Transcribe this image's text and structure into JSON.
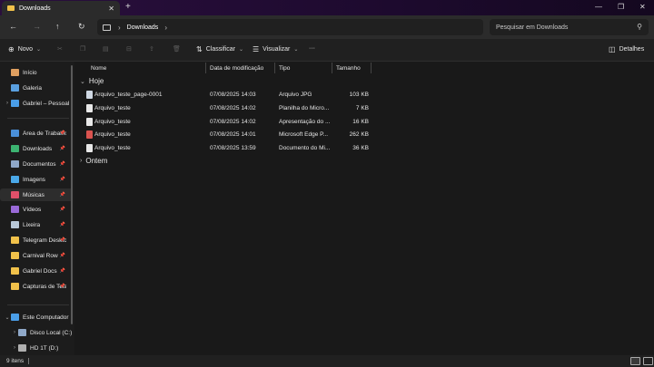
{
  "window": {
    "tab_title": "Downloads",
    "tab_close": "✕",
    "new_tab": "+",
    "minimize": "—",
    "maximize": "❐",
    "close": "✕"
  },
  "nav": {
    "back": "←",
    "forward": "→",
    "up": "↑",
    "refresh": "↻"
  },
  "address": {
    "crumbs": [
      "Downloads"
    ],
    "sep": "›"
  },
  "search": {
    "placeholder": "Pesquisar em Downloads",
    "icon": "⚲"
  },
  "toolbar": {
    "new_label": "Novo",
    "sort_label": "Classificar",
    "view_label": "Visualizar",
    "more": "···",
    "details_label": "Detalhes"
  },
  "sidebar": {
    "items": [
      {
        "label": "Início",
        "icon": "home-icon",
        "color": "#e0a060"
      },
      {
        "label": "Galeria",
        "icon": "gallery-icon",
        "color": "#5aa0e0"
      },
      {
        "label": "Gabriel – Pessoal",
        "icon": "onedrive-icon",
        "color": "#4a9ee8"
      },
      {
        "label": "Área de Trabalho",
        "icon": "desktop-icon",
        "color": "#4a8fd8"
      },
      {
        "label": "Downloads",
        "icon": "download-icon",
        "color": "#3cb371"
      },
      {
        "label": "Documentos",
        "icon": "documents-icon",
        "color": "#8fa8c8"
      },
      {
        "label": "Imagens",
        "icon": "pictures-icon",
        "color": "#4aa8e8"
      },
      {
        "label": "Músicas",
        "icon": "music-icon",
        "color": "#e0506a"
      },
      {
        "label": "Vídeos",
        "icon": "videos-icon",
        "color": "#9a6ad8"
      },
      {
        "label": "Lixeira",
        "icon": "recycle-bin-icon",
        "color": "#b8c8d8"
      },
      {
        "label": "Telegram Desktop",
        "icon": "folder-icon",
        "color": "#f0c14a"
      },
      {
        "label": "Carnival Row",
        "icon": "folder-icon",
        "color": "#f0c14a"
      },
      {
        "label": "Gabriel Docs",
        "icon": "folder-icon",
        "color": "#f0c14a"
      },
      {
        "label": "Capturas de Tela",
        "icon": "folder-icon",
        "color": "#f0c14a"
      },
      {
        "label": "Este Computador",
        "icon": "computer-icon",
        "color": "#4a9ee8"
      },
      {
        "label": "Disco Local (C:)",
        "icon": "drive-icon",
        "color": "#8fa8c8"
      },
      {
        "label": "HD 1T (D:)",
        "icon": "drive-icon",
        "color": "#b0b0b0"
      }
    ]
  },
  "columns": {
    "name": "Nome",
    "date": "Data de modificação",
    "type": "Tipo",
    "size": "Tamanho"
  },
  "groups": {
    "today": "Hoje",
    "yesterday": "Ontem"
  },
  "files": [
    {
      "name": "Arquivo_teste_page-0001",
      "date": "07/08/2025 14:03",
      "type": "Arquivo JPG",
      "size": "103 KB",
      "color": "#cfd8e3"
    },
    {
      "name": "Arquivo_teste",
      "date": "07/08/2025 14:02",
      "type": "Planilha do Micro...",
      "size": "7 KB",
      "color": "#e8e8e8"
    },
    {
      "name": "Arquivo_teste",
      "date": "07/08/2025 14:02",
      "type": "Apresentação do ...",
      "size": "16 KB",
      "color": "#e8e8e8"
    },
    {
      "name": "Arquivo_teste",
      "date": "07/08/2025 14:01",
      "type": "Microsoft Edge P...",
      "size": "262 KB",
      "color": "#d9534f"
    },
    {
      "name": "Arquivo_teste",
      "date": "07/08/2025 13:59",
      "type": "Documento do Mi...",
      "size": "36 KB",
      "color": "#e8e8e8"
    }
  ],
  "status": {
    "count": "9 itens"
  }
}
